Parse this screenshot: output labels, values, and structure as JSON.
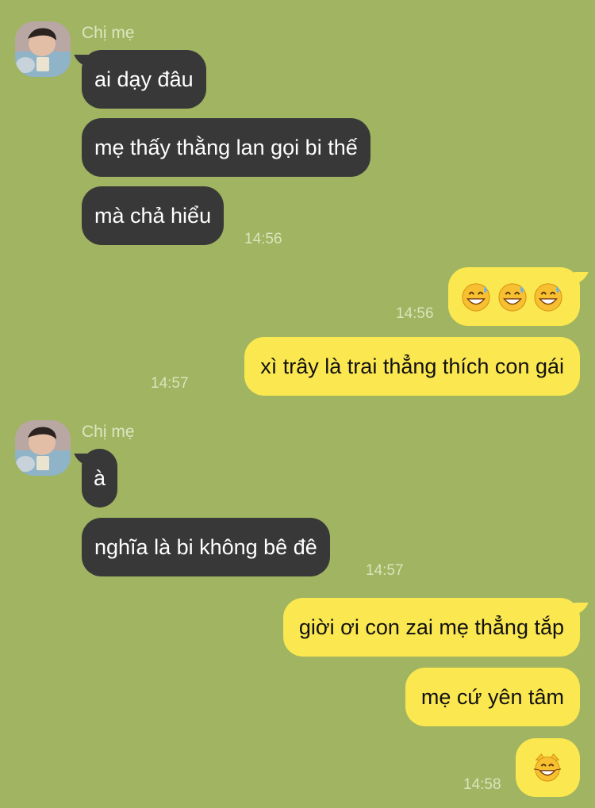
{
  "chat": {
    "groups": [
      {
        "sender": "Chị mẹ",
        "avatar_icon": "avatar-photo",
        "messages": [
          "ai dạy đâu",
          "mẹ thấy thằng lan gọi bi thế",
          "mà chả hiểu"
        ],
        "time": "14:56"
      },
      {
        "outgoing": [
          {
            "emoji": [
              "grinning-face-with-sweat",
              "grinning-face-with-sweat",
              "grinning-face-with-sweat"
            ],
            "time": "14:56"
          },
          {
            "text": "xì trây là trai thẳng thích con gái",
            "time": "14:57"
          }
        ]
      },
      {
        "sender": "Chị mẹ",
        "avatar_icon": "avatar-photo",
        "messages": [
          "à",
          "nghĩa là bi không bê đê"
        ],
        "time": "14:57"
      },
      {
        "outgoing": [
          {
            "text": "giời ơi con zai mẹ thẳng tắp"
          },
          {
            "text": "mẹ cứ yên tâm"
          },
          {
            "emoji": [
              "grinning-cat-face"
            ],
            "time": "14:58"
          }
        ]
      }
    ],
    "colors": {
      "background": "#a0b462",
      "incoming_bubble": "#383838",
      "outgoing_bubble": "#fbe74f"
    }
  }
}
